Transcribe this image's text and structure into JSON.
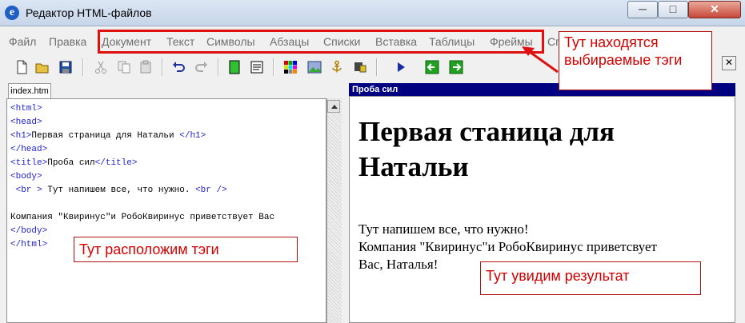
{
  "window": {
    "title": "Редактор HTML-файлов",
    "icon": "e"
  },
  "menu": [
    "Файл",
    "Правка",
    "Документ",
    "Текст",
    "Символы",
    "Абзацы",
    "Списки",
    "Вставка",
    "Таблицы",
    "Фреймы",
    "Сп"
  ],
  "editor": {
    "tab": "index.htm",
    "lines": [
      {
        "tag": "<html>"
      },
      {
        "tag": "<head>"
      },
      {
        "tag": "<h1>",
        "text": "Первая страница для Натальи ",
        "tag2": "</h1>"
      },
      {
        "tag": "</head>"
      },
      {
        "tag": "<title>",
        "text": "Проба сил",
        "tag2": "</title>"
      },
      {
        "tag": "<body>"
      },
      {
        "pre": " ",
        "tag": "<br >",
        "text": " Тут напишем все, что нужно. ",
        "tag2": "<br />"
      },
      {
        "text": ""
      },
      {
        "text": "Компания \"Квиринус\"и РобоКвиринус приветствует Вас"
      },
      {
        "tag": "</body>"
      },
      {
        "tag": "</html>"
      }
    ]
  },
  "preview": {
    "title": "Проба сил",
    "heading": "Первая станица для Натальи",
    "line1": "Тут напишем все, что нужно!",
    "line2": "Компания \"Квиринус\"и РобоКвиринус приветсвует",
    "line3": "Вас, Наталья!"
  },
  "annotations": {
    "tags_note": "Тут находятся выбираемые тэги",
    "left_note": "Тут расположим тэги",
    "right_note": "Тут увидим результат"
  },
  "colors": {
    "annotation": "#e01010",
    "preview_header": "#000080",
    "code_tag": "#1f1fd0"
  }
}
